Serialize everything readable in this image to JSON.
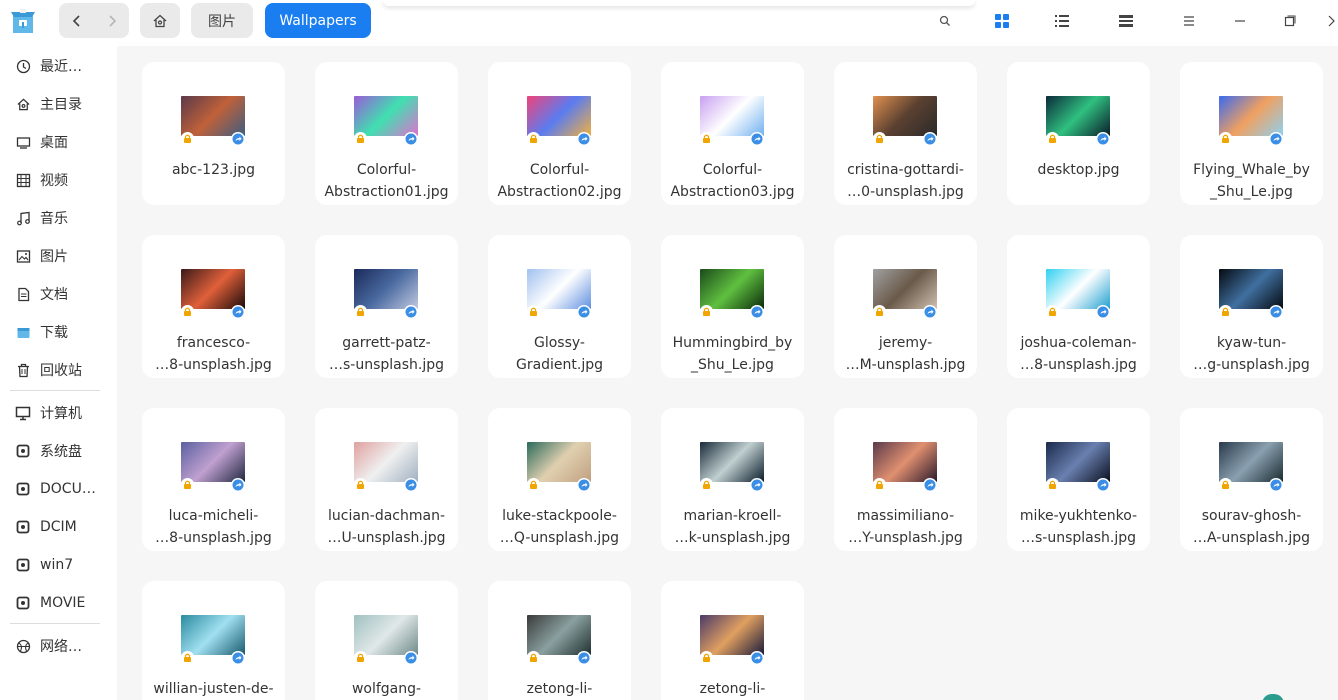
{
  "titlebar": {
    "breadcrumb": [
      "图片",
      "Wallpapers"
    ],
    "icons": {
      "app": "file-manager-icon",
      "back": "chevron-left-icon",
      "forward": "chevron-right-icon",
      "home": "home-icon",
      "search": "search-icon",
      "icon_view": "grid-view-icon",
      "list_view": "list-view-icon",
      "detail_view": "detail-view-icon",
      "menu": "menu-icon",
      "minimize": "minimize-icon",
      "maximize": "maximize-icon",
      "close": "close-icon"
    },
    "accent_color": "#1a7ef0"
  },
  "sidebar": {
    "items": [
      {
        "label": "最近…",
        "icon": "recent-icon"
      },
      {
        "label": "主目录",
        "icon": "home-icon"
      },
      {
        "label": "桌面",
        "icon": "desktop-icon"
      },
      {
        "label": "视频",
        "icon": "video-icon"
      },
      {
        "label": "音乐",
        "icon": "music-icon"
      },
      {
        "label": "图片",
        "icon": "picture-icon"
      },
      {
        "label": "文档",
        "icon": "document-icon"
      },
      {
        "label": "下载",
        "icon": "download-icon"
      },
      {
        "label": "回收站",
        "icon": "trash-icon"
      },
      {
        "label": "计算机",
        "icon": "computer-icon"
      },
      {
        "label": "系统盘",
        "icon": "disk-icon"
      },
      {
        "label": "DOCU…",
        "icon": "disk-icon"
      },
      {
        "label": "DCIM",
        "icon": "disk-icon"
      },
      {
        "label": "win7",
        "icon": "disk-icon"
      },
      {
        "label": "MOVIE",
        "icon": "disk-icon"
      },
      {
        "label": "网络…",
        "icon": "network-icon"
      }
    ]
  },
  "files": [
    {
      "line1": "abc-123.jpg",
      "line2": "",
      "colors": [
        "#5a3a4a",
        "#c0613a",
        "#3d5d80"
      ]
    },
    {
      "line1": "Colorful-",
      "line2": "Abstraction01.jpg",
      "colors": [
        "#9a5bd8",
        "#40e0b0",
        "#e070d0"
      ]
    },
    {
      "line1": "Colorful-",
      "line2": "Abstraction02.jpg",
      "colors": [
        "#f0437a",
        "#5a7cf0",
        "#f0b040"
      ]
    },
    {
      "line1": "Colorful-",
      "line2": "Abstraction03.jpg",
      "colors": [
        "#c8a0f0",
        "#ffffff",
        "#70b0f0"
      ]
    },
    {
      "line1": "cristina-gottardi-",
      "line2": "…0-unsplash.jpg",
      "colors": [
        "#e09050",
        "#5a4030",
        "#2a2a2a"
      ]
    },
    {
      "line1": "desktop.jpg",
      "line2": "",
      "colors": [
        "#0a2a3a",
        "#30c080",
        "#0a1a2a"
      ]
    },
    {
      "line1": "Flying_Whale_by",
      "line2": "_Shu_Le.jpg",
      "colors": [
        "#3a6af0",
        "#f0a060",
        "#8fd0f0"
      ]
    },
    {
      "line1": "francesco-",
      "line2": "…8-unsplash.jpg",
      "colors": [
        "#3a1a1a",
        "#e0603a",
        "#1a0a0a"
      ]
    },
    {
      "line1": "garrett-patz-",
      "line2": "…s-unsplash.jpg",
      "colors": [
        "#1a2a5a",
        "#4a6aa0",
        "#c0c8e0"
      ]
    },
    {
      "line1": "Glossy-",
      "line2": "Gradient.jpg",
      "colors": [
        "#a0c0f0",
        "#ffffff",
        "#6090e0"
      ]
    },
    {
      "line1": "Hummingbird_by",
      "line2": "_Shu_Le.jpg",
      "colors": [
        "#1a4a1a",
        "#60c040",
        "#0a2a0a"
      ]
    },
    {
      "line1": "jeremy-",
      "line2": "…M-unsplash.jpg",
      "colors": [
        "#a0a0a0",
        "#6a5a4a",
        "#d0c0b0"
      ]
    },
    {
      "line1": "joshua-coleman-",
      "line2": "…8-unsplash.jpg",
      "colors": [
        "#30d0f0",
        "#ffffff",
        "#20a0d0"
      ]
    },
    {
      "line1": "kyaw-tun-",
      "line2": "…g-unsplash.jpg",
      "colors": [
        "#050a10",
        "#4070a0",
        "#050a10"
      ]
    },
    {
      "line1": "luca-micheli-",
      "line2": "…8-unsplash.jpg",
      "colors": [
        "#5a60a0",
        "#c0a0d0",
        "#202840"
      ]
    },
    {
      "line1": "lucian-dachman-",
      "line2": "…U-unsplash.jpg",
      "colors": [
        "#e0a0a0",
        "#f0f0f0",
        "#a0b0c0"
      ]
    },
    {
      "line1": "luke-stackpoole-",
      "line2": "…Q-unsplash.jpg",
      "colors": [
        "#2a6a5a",
        "#e0d0b0",
        "#c0a080"
      ]
    },
    {
      "line1": "marian-kroell-",
      "line2": "…k-unsplash.jpg",
      "colors": [
        "#1a2a3a",
        "#c0d0d0",
        "#0a1a2a"
      ]
    },
    {
      "line1": "massimiliano-",
      "line2": "…Y-unsplash.jpg",
      "colors": [
        "#5a3a4a",
        "#e09070",
        "#2a1a2a"
      ]
    },
    {
      "line1": "mike-yukhtenko-",
      "line2": "…s-unsplash.jpg",
      "colors": [
        "#1a2a4a",
        "#6a80b0",
        "#0a1020"
      ]
    },
    {
      "line1": "sourav-ghosh-",
      "line2": "…A-unsplash.jpg",
      "colors": [
        "#2a3a4a",
        "#8aa0b0",
        "#1a2a30"
      ]
    },
    {
      "line1": "willian-justen-de-",
      "line2": "",
      "colors": [
        "#2a8aa0",
        "#a0e0f0",
        "#1a5a70"
      ]
    },
    {
      "line1": "wolfgang-",
      "line2": "",
      "colors": [
        "#a0c0c0",
        "#e0e8e8",
        "#708a8a"
      ]
    },
    {
      "line1": "zetong-li-",
      "line2": "",
      "colors": [
        "#3a3a3a",
        "#8aa0a0",
        "#203030"
      ]
    },
    {
      "line1": "zetong-li-",
      "line2": "",
      "colors": [
        "#4a3a6a",
        "#e0a060",
        "#1a1a3a"
      ]
    }
  ]
}
